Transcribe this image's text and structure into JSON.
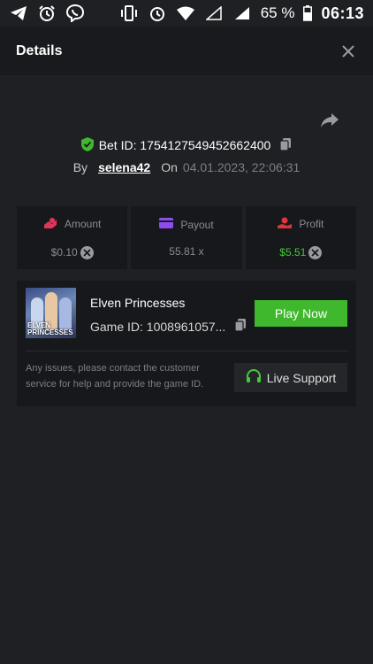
{
  "status_bar": {
    "battery": "65 %",
    "time": "06:13",
    "left_icons": [
      "telegram-icon",
      "alarm-icon",
      "viber-icon"
    ],
    "right_icons": [
      "vibrate-icon",
      "alarm-icon",
      "wifi-icon",
      "signal-empty-icon",
      "signal-icon",
      "battery-icon"
    ]
  },
  "header": {
    "title": "Details"
  },
  "bet": {
    "id_text": "Bet ID: 1754127549452662400",
    "by_label": "By",
    "user": "selena42",
    "on_label": "On",
    "date": "04.01.2023, 22:06:31"
  },
  "stats": {
    "amount": {
      "label": "Amount",
      "value": "$0.10"
    },
    "payout": {
      "label": "Payout",
      "value": "55.81 x"
    },
    "profit": {
      "label": "Profit",
      "value": "$5.51"
    }
  },
  "game": {
    "title": "Elven Princesses",
    "id_text": "Game ID: 1008961057...",
    "thumb_text": "ELVEN PRINCESSES",
    "play_label": "Play Now",
    "help_text": "Any issues, please contact the customer service for help and provide the game ID.",
    "support_label": "Live Support"
  },
  "colors": {
    "background": "#1f2023",
    "panel": "#17181b",
    "accent_green": "#3fb82e",
    "amount_icon": "#e0355a",
    "payout_icon": "#8c4cf0",
    "profit_icon": "#e0343a"
  }
}
